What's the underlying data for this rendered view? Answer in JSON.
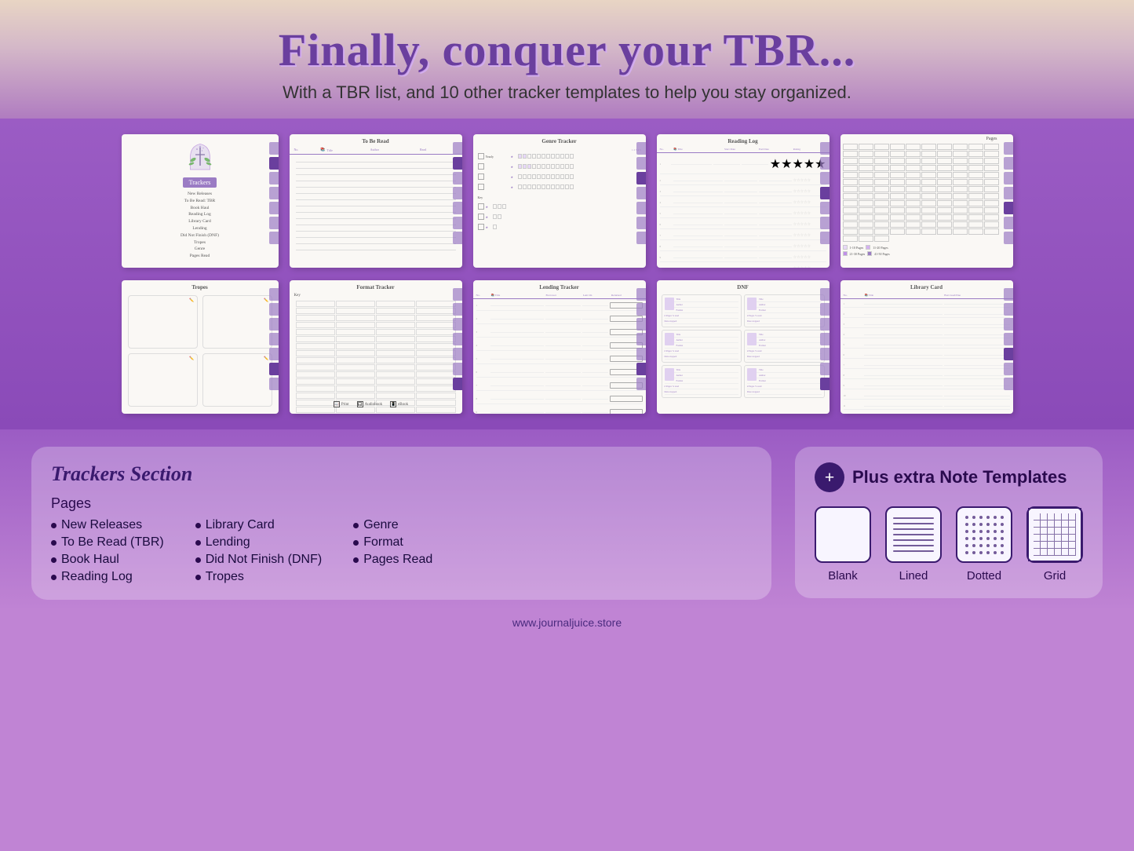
{
  "header": {
    "main_title": "Finally, conquer your TBR...",
    "subtitle": "With a TBR list, and 10 other tracker templates to help you stay organized."
  },
  "preview_row1": {
    "cards": [
      {
        "id": "trackers-cover",
        "label": "Trackers"
      },
      {
        "id": "to-be-read",
        "label": "To Be Read"
      },
      {
        "id": "genre-tracker",
        "label": "Genre Tracker"
      },
      {
        "id": "reading-log",
        "label": "Reading Log"
      },
      {
        "id": "pages-read",
        "label": "Pages"
      }
    ]
  },
  "preview_row2": {
    "cards": [
      {
        "id": "tropes",
        "label": "Tropes"
      },
      {
        "id": "format-tracker",
        "label": "Format Tracker"
      },
      {
        "id": "lending-tracker",
        "label": "Lending Tracker"
      },
      {
        "id": "dnf",
        "label": "DNF"
      },
      {
        "id": "library-card",
        "label": "Library Card"
      }
    ]
  },
  "trackers_section": {
    "title": "Trackers Section",
    "pages_label": "Pages",
    "col1": [
      "New Releases",
      "To Be Read (TBR)",
      "Book Haul",
      "Reading Log"
    ],
    "col2": [
      "Library Card",
      "Lending",
      "Did Not Finish (DNF)",
      "Tropes"
    ],
    "col3": [
      "Genre",
      "Format",
      "Pages Read"
    ]
  },
  "plus_section": {
    "plus_symbol": "+",
    "title": "Plus extra Note Templates",
    "templates": [
      {
        "id": "blank",
        "label": "Blank"
      },
      {
        "id": "lined",
        "label": "Lined"
      },
      {
        "id": "dotted",
        "label": "Dotted"
      },
      {
        "id": "grid",
        "label": "Grid"
      }
    ]
  },
  "footer": {
    "url": "www.journaljuice.store"
  },
  "sidebar_items": [
    "New Releases",
    "To Be Read: TBR",
    "Book Haul",
    "Reading Log",
    "Library Card",
    "Lending",
    "Did Not Finish: DNF",
    "Tropes",
    "Genre",
    "Pages Read"
  ],
  "card_headers": {
    "tbr": "To Be Read",
    "genre": "Genre Tracker",
    "reading_log": "Reading Log",
    "format": "Format Tracker",
    "lending": "Lending Tracker",
    "dnf": "DNF",
    "library": "Library Card"
  }
}
